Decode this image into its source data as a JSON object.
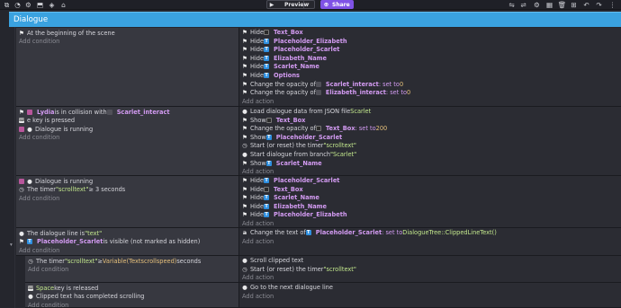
{
  "toolbar": {
    "left_icons": [
      "project-icon",
      "events-icon",
      "settings-icon",
      "shapes-icon",
      "cube-icon",
      "home-icon"
    ],
    "preview_label": "Preview",
    "share_label": "Share",
    "right_icons": [
      "sliders-icon",
      "sliders-alt-icon",
      "settings-icon",
      "calendar-icon",
      "trash-icon",
      "add-event-icon",
      "undo-icon",
      "redo-icon",
      "more-icon"
    ]
  },
  "group": {
    "title": "Dialogue"
  },
  "events": [
    {
      "conditions": [
        {
          "icon": "flag",
          "parts": [
            {
              "t": "At the beginning of the scene",
              "c": ""
            }
          ]
        }
      ],
      "add_condition": "Add condition",
      "actions": [
        {
          "icon": "flag",
          "parts": [
            {
              "t": "Hide ",
              "c": ""
            },
            {
              "t": "Text_Box",
              "c": "obj",
              "oicon": "txt"
            }
          ]
        },
        {
          "icon": "flag",
          "parts": [
            {
              "t": "Hide ",
              "c": ""
            },
            {
              "t": "Placeholder_Elizabeth",
              "c": "obj",
              "oicon": "blue"
            }
          ]
        },
        {
          "icon": "flag",
          "parts": [
            {
              "t": "Hide ",
              "c": ""
            },
            {
              "t": "Placeholder_Scarlet",
              "c": "obj",
              "oicon": "blue"
            }
          ]
        },
        {
          "icon": "flag",
          "parts": [
            {
              "t": "Hide ",
              "c": ""
            },
            {
              "t": "Elizabeth_Name",
              "c": "obj",
              "oicon": "blue"
            }
          ]
        },
        {
          "icon": "flag",
          "parts": [
            {
              "t": "Hide ",
              "c": ""
            },
            {
              "t": "Scarlet_Name",
              "c": "obj",
              "oicon": "blue"
            }
          ]
        },
        {
          "icon": "flag",
          "parts": [
            {
              "t": "Hide ",
              "c": ""
            },
            {
              "t": "Options",
              "c": "obj",
              "oicon": "blue"
            }
          ]
        },
        {
          "icon": "flag",
          "parts": [
            {
              "t": "Change the opacity of ",
              "c": ""
            },
            {
              "t": "Scarlet_interact",
              "c": "obj",
              "oicon": "sq"
            },
            {
              "t": ": set to ",
              "c": "purp"
            },
            {
              "t": "0",
              "c": "num"
            }
          ]
        },
        {
          "icon": "flag",
          "parts": [
            {
              "t": "Change the opacity of ",
              "c": ""
            },
            {
              "t": "Elizabeth_interact",
              "c": "obj",
              "oicon": "sq"
            },
            {
              "t": ": set to ",
              "c": "purp"
            },
            {
              "t": "0",
              "c": "num"
            }
          ]
        }
      ],
      "add_action": "Add action"
    },
    {
      "conditions": [
        {
          "icon": "flag",
          "parts": [
            {
              "t": "",
              "c": "",
              "oicon": "lyd"
            },
            {
              "t": "Lydia",
              "c": "obj"
            },
            {
              "t": " is in collision with ",
              "c": ""
            },
            {
              "t": "Scarlet_interact",
              "c": "obj",
              "oicon": "sq"
            }
          ]
        },
        {
          "icon": "key",
          "parts": [
            {
              "t": "e key is pressed",
              "c": ""
            }
          ]
        },
        {
          "icon": "lyd",
          "parts": [
            {
              "t": "",
              "c": "",
              "oicon": "dot"
            },
            {
              "t": "Dialogue is running",
              "c": ""
            }
          ]
        }
      ],
      "add_condition": "Add condition",
      "actions": [
        {
          "icon": "dot",
          "parts": [
            {
              "t": "Load dialogue data from JSON file ",
              "c": ""
            },
            {
              "t": "Scarlet",
              "c": "str"
            }
          ]
        },
        {
          "icon": "flag",
          "parts": [
            {
              "t": "Show ",
              "c": ""
            },
            {
              "t": "Text_Box",
              "c": "obj",
              "oicon": "txt"
            }
          ]
        },
        {
          "icon": "flag",
          "parts": [
            {
              "t": "Change the opacity of ",
              "c": ""
            },
            {
              "t": "Text_Box",
              "c": "obj",
              "oicon": "txt"
            },
            {
              "t": ": set to ",
              "c": "purp"
            },
            {
              "t": "200",
              "c": "num"
            }
          ]
        },
        {
          "icon": "flag",
          "parts": [
            {
              "t": "Show ",
              "c": ""
            },
            {
              "t": "Placeholder_Scarlet",
              "c": "obj",
              "oicon": "blue"
            }
          ]
        },
        {
          "icon": "time",
          "parts": [
            {
              "t": "Start (or reset) the timer ",
              "c": ""
            },
            {
              "t": "\"scrolltext\"",
              "c": "str"
            }
          ]
        },
        {
          "icon": "dot",
          "parts": [
            {
              "t": "Start dialogue from branch ",
              "c": ""
            },
            {
              "t": "\"Scarlet\"",
              "c": "str"
            }
          ]
        },
        {
          "icon": "flag",
          "parts": [
            {
              "t": "Show ",
              "c": ""
            },
            {
              "t": "Scarlet_Name",
              "c": "obj",
              "oicon": "blue"
            }
          ]
        }
      ],
      "add_action": "Add action"
    },
    {
      "conditions": [
        {
          "icon": "lyd",
          "parts": [
            {
              "t": "",
              "c": "",
              "oicon": "dot"
            },
            {
              "t": "Dialogue is running",
              "c": ""
            }
          ]
        },
        {
          "icon": "time",
          "parts": [
            {
              "t": "The timer ",
              "c": ""
            },
            {
              "t": "\"scrolltext\"",
              "c": "str"
            },
            {
              "t": " ≥ 3 seconds",
              "c": ""
            }
          ]
        }
      ],
      "add_condition": "Add condition",
      "actions": [
        {
          "icon": "flag",
          "parts": [
            {
              "t": "Hide ",
              "c": ""
            },
            {
              "t": "Placeholder_Scarlet",
              "c": "obj",
              "oicon": "blue"
            }
          ]
        },
        {
          "icon": "flag",
          "parts": [
            {
              "t": "Hide ",
              "c": ""
            },
            {
              "t": "Text_Box",
              "c": "obj",
              "oicon": "txt"
            }
          ]
        },
        {
          "icon": "flag",
          "parts": [
            {
              "t": "Hide ",
              "c": ""
            },
            {
              "t": "Scarlet_Name",
              "c": "obj",
              "oicon": "blue"
            }
          ]
        },
        {
          "icon": "flag",
          "parts": [
            {
              "t": "Hide ",
              "c": ""
            },
            {
              "t": "Elizabeth_Name",
              "c": "obj",
              "oicon": "blue"
            }
          ]
        },
        {
          "icon": "flag",
          "parts": [
            {
              "t": "Hide ",
              "c": ""
            },
            {
              "t": "Placeholder_Elizabeth",
              "c": "obj",
              "oicon": "blue"
            }
          ]
        }
      ],
      "add_action": "Add action"
    },
    {
      "conditions": [
        {
          "icon": "dot",
          "parts": [
            {
              "t": "The dialogue line is ",
              "c": ""
            },
            {
              "t": "\"text\"",
              "c": "str"
            }
          ]
        },
        {
          "icon": "flag",
          "parts": [
            {
              "t": "",
              "c": "",
              "oicon": "blue"
            },
            {
              "t": "Placeholder_Scarlet",
              "c": "obj"
            },
            {
              "t": " is visible (not marked as hidden)",
              "c": ""
            }
          ]
        }
      ],
      "add_condition": "Add condition",
      "actions": [
        {
          "icon": "abc",
          "parts": [
            {
              "t": "Change the text of ",
              "c": ""
            },
            {
              "t": "Placeholder_Scarlet",
              "c": "obj",
              "oicon": "blue"
            },
            {
              "t": ": set to ",
              "c": "purp"
            },
            {
              "t": "DialogueTree::ClippedLineText()",
              "c": "str"
            }
          ]
        }
      ],
      "add_action": "Add action"
    },
    {
      "conditions": [
        {
          "icon": "time",
          "parts": [
            {
              "t": "The timer ",
              "c": ""
            },
            {
              "t": "\"scrolltext\"",
              "c": "str"
            },
            {
              "t": " ≥ ",
              "c": ""
            },
            {
              "t": "Variable(Textscrollspeed)",
              "c": "num"
            },
            {
              "t": " seconds",
              "c": ""
            }
          ]
        }
      ],
      "add_condition": "Add condition",
      "actions": [
        {
          "icon": "dot",
          "parts": [
            {
              "t": "Scroll clipped text",
              "c": ""
            }
          ]
        },
        {
          "icon": "time",
          "parts": [
            {
              "t": "Start (or reset) the timer ",
              "c": ""
            },
            {
              "t": "\"scrolltext\"",
              "c": "str"
            }
          ]
        }
      ],
      "add_action": "Add action"
    },
    {
      "conditions": [
        {
          "icon": "key",
          "parts": [
            {
              "t": "Space",
              "c": "str"
            },
            {
              "t": " key is released",
              "c": ""
            }
          ]
        },
        {
          "icon": "dot",
          "parts": [
            {
              "t": "Clipped text has completed scrolling",
              "c": ""
            }
          ]
        }
      ],
      "add_condition": "Add condition",
      "actions": [
        {
          "icon": "dot",
          "parts": [
            {
              "t": "Go to the next dialogue line",
              "c": ""
            }
          ]
        }
      ],
      "add_action": "Add action"
    }
  ]
}
